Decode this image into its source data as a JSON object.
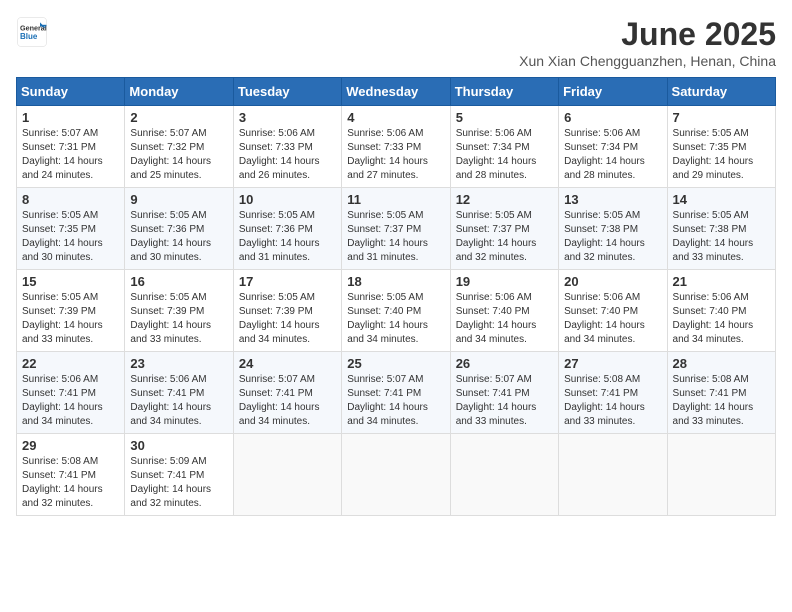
{
  "header": {
    "logo_line1": "General",
    "logo_line2": "Blue",
    "title": "June 2025",
    "subtitle": "Xun Xian Chengguanzhen, Henan, China"
  },
  "weekdays": [
    "Sunday",
    "Monday",
    "Tuesday",
    "Wednesday",
    "Thursday",
    "Friday",
    "Saturday"
  ],
  "weeks": [
    [
      {
        "day": "1",
        "info": "Sunrise: 5:07 AM\nSunset: 7:31 PM\nDaylight: 14 hours\nand 24 minutes."
      },
      {
        "day": "2",
        "info": "Sunrise: 5:07 AM\nSunset: 7:32 PM\nDaylight: 14 hours\nand 25 minutes."
      },
      {
        "day": "3",
        "info": "Sunrise: 5:06 AM\nSunset: 7:33 PM\nDaylight: 14 hours\nand 26 minutes."
      },
      {
        "day": "4",
        "info": "Sunrise: 5:06 AM\nSunset: 7:33 PM\nDaylight: 14 hours\nand 27 minutes."
      },
      {
        "day": "5",
        "info": "Sunrise: 5:06 AM\nSunset: 7:34 PM\nDaylight: 14 hours\nand 28 minutes."
      },
      {
        "day": "6",
        "info": "Sunrise: 5:06 AM\nSunset: 7:34 PM\nDaylight: 14 hours\nand 28 minutes."
      },
      {
        "day": "7",
        "info": "Sunrise: 5:05 AM\nSunset: 7:35 PM\nDaylight: 14 hours\nand 29 minutes."
      }
    ],
    [
      {
        "day": "8",
        "info": "Sunrise: 5:05 AM\nSunset: 7:35 PM\nDaylight: 14 hours\nand 30 minutes."
      },
      {
        "day": "9",
        "info": "Sunrise: 5:05 AM\nSunset: 7:36 PM\nDaylight: 14 hours\nand 30 minutes."
      },
      {
        "day": "10",
        "info": "Sunrise: 5:05 AM\nSunset: 7:36 PM\nDaylight: 14 hours\nand 31 minutes."
      },
      {
        "day": "11",
        "info": "Sunrise: 5:05 AM\nSunset: 7:37 PM\nDaylight: 14 hours\nand 31 minutes."
      },
      {
        "day": "12",
        "info": "Sunrise: 5:05 AM\nSunset: 7:37 PM\nDaylight: 14 hours\nand 32 minutes."
      },
      {
        "day": "13",
        "info": "Sunrise: 5:05 AM\nSunset: 7:38 PM\nDaylight: 14 hours\nand 32 minutes."
      },
      {
        "day": "14",
        "info": "Sunrise: 5:05 AM\nSunset: 7:38 PM\nDaylight: 14 hours\nand 33 minutes."
      }
    ],
    [
      {
        "day": "15",
        "info": "Sunrise: 5:05 AM\nSunset: 7:39 PM\nDaylight: 14 hours\nand 33 minutes."
      },
      {
        "day": "16",
        "info": "Sunrise: 5:05 AM\nSunset: 7:39 PM\nDaylight: 14 hours\nand 33 minutes."
      },
      {
        "day": "17",
        "info": "Sunrise: 5:05 AM\nSunset: 7:39 PM\nDaylight: 14 hours\nand 34 minutes."
      },
      {
        "day": "18",
        "info": "Sunrise: 5:05 AM\nSunset: 7:40 PM\nDaylight: 14 hours\nand 34 minutes."
      },
      {
        "day": "19",
        "info": "Sunrise: 5:06 AM\nSunset: 7:40 PM\nDaylight: 14 hours\nand 34 minutes."
      },
      {
        "day": "20",
        "info": "Sunrise: 5:06 AM\nSunset: 7:40 PM\nDaylight: 14 hours\nand 34 minutes."
      },
      {
        "day": "21",
        "info": "Sunrise: 5:06 AM\nSunset: 7:40 PM\nDaylight: 14 hours\nand 34 minutes."
      }
    ],
    [
      {
        "day": "22",
        "info": "Sunrise: 5:06 AM\nSunset: 7:41 PM\nDaylight: 14 hours\nand 34 minutes."
      },
      {
        "day": "23",
        "info": "Sunrise: 5:06 AM\nSunset: 7:41 PM\nDaylight: 14 hours\nand 34 minutes."
      },
      {
        "day": "24",
        "info": "Sunrise: 5:07 AM\nSunset: 7:41 PM\nDaylight: 14 hours\nand 34 minutes."
      },
      {
        "day": "25",
        "info": "Sunrise: 5:07 AM\nSunset: 7:41 PM\nDaylight: 14 hours\nand 34 minutes."
      },
      {
        "day": "26",
        "info": "Sunrise: 5:07 AM\nSunset: 7:41 PM\nDaylight: 14 hours\nand 33 minutes."
      },
      {
        "day": "27",
        "info": "Sunrise: 5:08 AM\nSunset: 7:41 PM\nDaylight: 14 hours\nand 33 minutes."
      },
      {
        "day": "28",
        "info": "Sunrise: 5:08 AM\nSunset: 7:41 PM\nDaylight: 14 hours\nand 33 minutes."
      }
    ],
    [
      {
        "day": "29",
        "info": "Sunrise: 5:08 AM\nSunset: 7:41 PM\nDaylight: 14 hours\nand 32 minutes."
      },
      {
        "day": "30",
        "info": "Sunrise: 5:09 AM\nSunset: 7:41 PM\nDaylight: 14 hours\nand 32 minutes."
      },
      null,
      null,
      null,
      null,
      null
    ]
  ]
}
